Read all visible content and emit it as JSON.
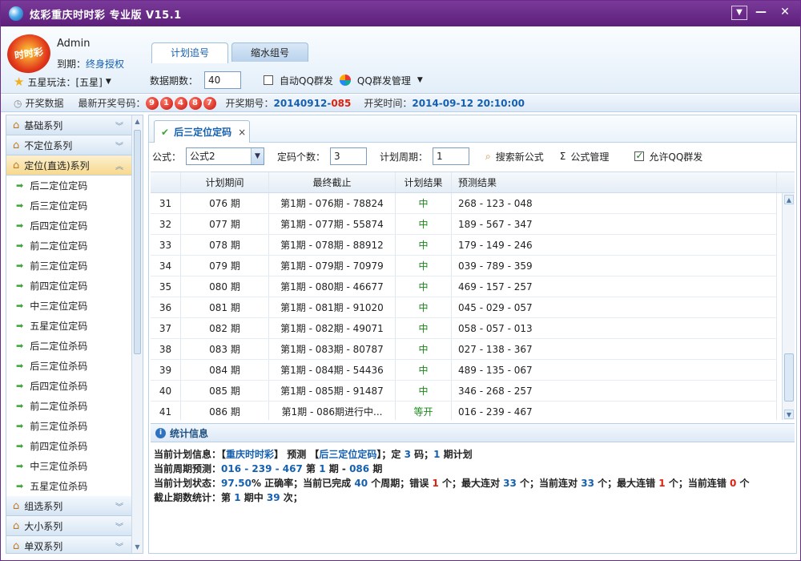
{
  "window": {
    "title": "炫彩重庆时时彩 专业版 V15.1"
  },
  "user": {
    "logo_text": "时时彩",
    "name": "Admin",
    "expire_label": "到期：",
    "expire_value": "终身授权",
    "play_label": "五星玩法：[五星]"
  },
  "tabs": [
    "计划追号",
    "缩水组号"
  ],
  "controls": {
    "periods_label": "数据期数：",
    "periods_value": "40",
    "auto_qq_label": "自动QQ群发",
    "qq_manage_label": "QQ群发管理"
  },
  "status": {
    "open_data": "开奖数据",
    "latest_label": "最新开奖号码：",
    "balls": [
      "9",
      "1",
      "4",
      "8",
      "7"
    ],
    "issue_label": "开奖期号：",
    "issue_main": "20140912-",
    "issue_suffix": "085",
    "time_label": "开奖时间：",
    "time_value": "2014-09-12 20:10:00"
  },
  "sidebar": {
    "sections_top": [
      "基础系列",
      "不定位系列",
      "定位(直选)系列"
    ],
    "items": [
      "后二定位定码",
      "后三定位定码",
      "后四定位定码",
      "前二定位定码",
      "前三定位定码",
      "前四定位定码",
      "中三定位定码",
      "五星定位定码",
      "后二定位杀码",
      "后三定位杀码",
      "后四定位杀码",
      "前二定位杀码",
      "前三定位杀码",
      "前四定位杀码",
      "中三定位杀码",
      "五星定位杀码"
    ],
    "sections_bottom": [
      "组选系列",
      "大小系列",
      "单双系列"
    ]
  },
  "doc_tab": {
    "label": "后三定位定码",
    "close": "×"
  },
  "formula": {
    "label": "公式：",
    "value": "公式2",
    "count_label": "定码个数：",
    "count_value": "3",
    "cycle_label": "计划周期：",
    "cycle_value": "1",
    "search_label": "搜索新公式",
    "manage_label": "公式管理",
    "allow_qq_label": "允许QQ群发"
  },
  "table": {
    "headers": [
      "",
      "计划期间",
      "最终截止",
      "计划结果",
      "预测结果"
    ],
    "rows": [
      [
        "31",
        "076 期",
        "第1期 - 076期 - 78824",
        "中",
        "268 - 123 - 048"
      ],
      [
        "32",
        "077 期",
        "第1期 - 077期 - 55874",
        "中",
        "189 - 567 - 347"
      ],
      [
        "33",
        "078 期",
        "第1期 - 078期 - 88912",
        "中",
        "179 - 149 - 246"
      ],
      [
        "34",
        "079 期",
        "第1期 - 079期 - 70979",
        "中",
        "039 - 789 - 359"
      ],
      [
        "35",
        "080 期",
        "第1期 - 080期 - 46677",
        "中",
        "469 - 157 - 257"
      ],
      [
        "36",
        "081 期",
        "第1期 - 081期 - 91020",
        "中",
        "045 - 029 - 057"
      ],
      [
        "37",
        "082 期",
        "第1期 - 082期 - 49071",
        "中",
        "058 - 057 - 013"
      ],
      [
        "38",
        "083 期",
        "第1期 - 083期 - 80787",
        "中",
        "027 - 138 - 367"
      ],
      [
        "39",
        "084 期",
        "第1期 - 084期 - 54436",
        "中",
        "489 - 135 - 067"
      ],
      [
        "40",
        "085 期",
        "第1期 - 085期 - 91487",
        "中",
        "346 - 268 - 257"
      ],
      [
        "41",
        "086 期",
        "第1期 - 086期进行中...",
        "等开",
        "016 - 239 - 467"
      ]
    ]
  },
  "stats": {
    "header": "统计信息",
    "l1": {
      "a": "当前计划信息：【",
      "b": "重庆时时彩",
      "c": "】 预测 【",
      "d": "后三定位定码",
      "e": "】；定 ",
      "f": "3",
      "g": " 码；",
      "h": "1",
      "i": " 期计划"
    },
    "l2": {
      "a": "当前周期预测：",
      "b": "016 - 239 - 467",
      "c": " 第 ",
      "d": "1",
      "e": " 期 - ",
      "f": "086",
      "g": " 期"
    },
    "l3": {
      "a": "当前计划状态：",
      "b": "97.50",
      "c": "% 正确率；当前已完成 ",
      "d": "40",
      "e": " 个周期；错误 ",
      "f": "1",
      "g": " 个；最大连对 ",
      "h": "33",
      "i": " 个；当前连对 ",
      "j": "33",
      "k": " 个；最大连错 ",
      "l": "1",
      "m": " 个；当前连错 ",
      "n": "0",
      "o": " 个"
    },
    "l4": {
      "a": "截止期数统计：第 ",
      "b": "1",
      "c": " 期中 ",
      "d": "39",
      "e": " 次；"
    }
  }
}
